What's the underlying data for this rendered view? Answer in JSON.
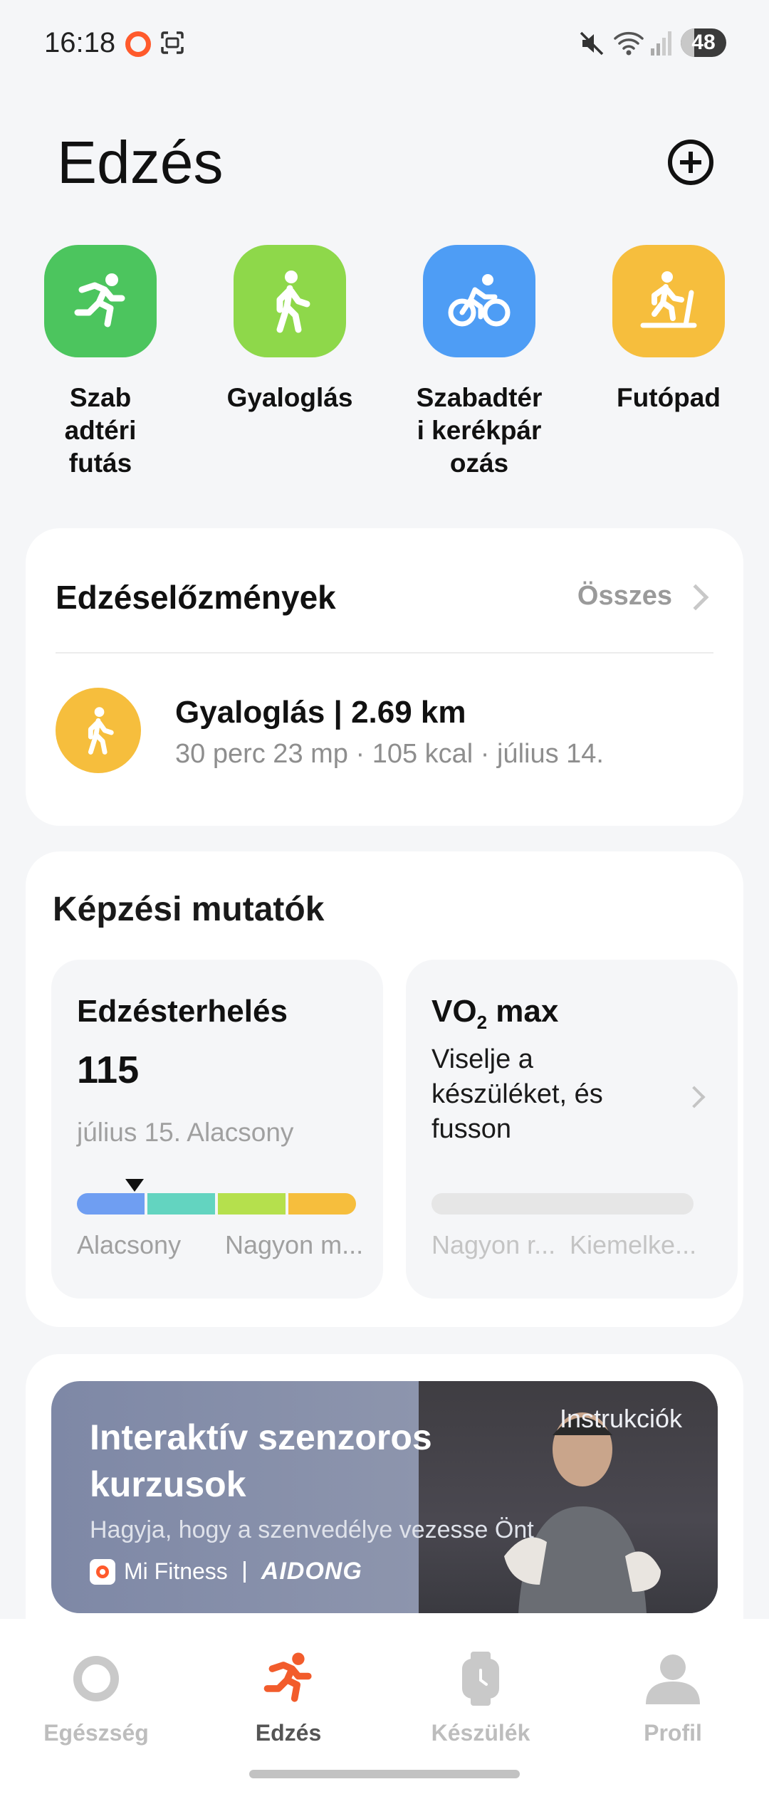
{
  "status_bar": {
    "time": "16:18",
    "battery": "48"
  },
  "header": {
    "title": "Edzés"
  },
  "workout_types": [
    {
      "label": "Szab\nadtéri\nfutás",
      "icon": "running-icon",
      "color": "#4cc55e"
    },
    {
      "label": "Gyaloglás",
      "icon": "walking-icon",
      "color": "#8ed84a"
    },
    {
      "label": "Szabadtér\ni kerékpár\nozás",
      "icon": "cycling-icon",
      "color": "#4e9df5"
    },
    {
      "label": "Futópad",
      "icon": "treadmill-icon",
      "color": "#f6be3d"
    }
  ],
  "history": {
    "title": "Edzéselőzmények",
    "all_label": "Összes",
    "item": {
      "name": "Gyaloglás | 2.69 km",
      "detail": "30 perc 23 mp · 105 kcal · július 14.",
      "icon": "walking-icon",
      "color": "#f6be3d"
    }
  },
  "metrics": {
    "title": "Képzési mutatók",
    "training_load": {
      "title": "Edzésterhelés",
      "value": "115",
      "date_status": "július 15. Alacsony",
      "scale_low": "Alacsony",
      "scale_high": "Nagyon m...",
      "segment_colors": [
        "#6f9ef2",
        "#63d4c0",
        "#b5e04d",
        "#f6be3d"
      ]
    },
    "vo2max": {
      "title_main": "VO",
      "title_sub": "2",
      "title_rest": " max",
      "message": "Viselje a készüléket, és fusson",
      "scale_low": "Nagyon r...",
      "scale_high": "Kiemelke..."
    }
  },
  "course": {
    "title": "Interaktív szenzoros kurzusok",
    "subtitle": "Hagyja, hogy a szenvedélye vezesse Önt",
    "brand": "Mi Fitness",
    "partner": "AIDONG",
    "instructions": "Instrukciók"
  },
  "bottom_nav": [
    {
      "label": "Egészség",
      "icon": "health-ring-icon",
      "active": false
    },
    {
      "label": "Edzés",
      "icon": "running-icon",
      "active": true
    },
    {
      "label": "Készülék",
      "icon": "watch-icon",
      "active": false
    },
    {
      "label": "Profil",
      "icon": "profile-icon",
      "active": false
    }
  ],
  "accent_color": "#f25c2c"
}
